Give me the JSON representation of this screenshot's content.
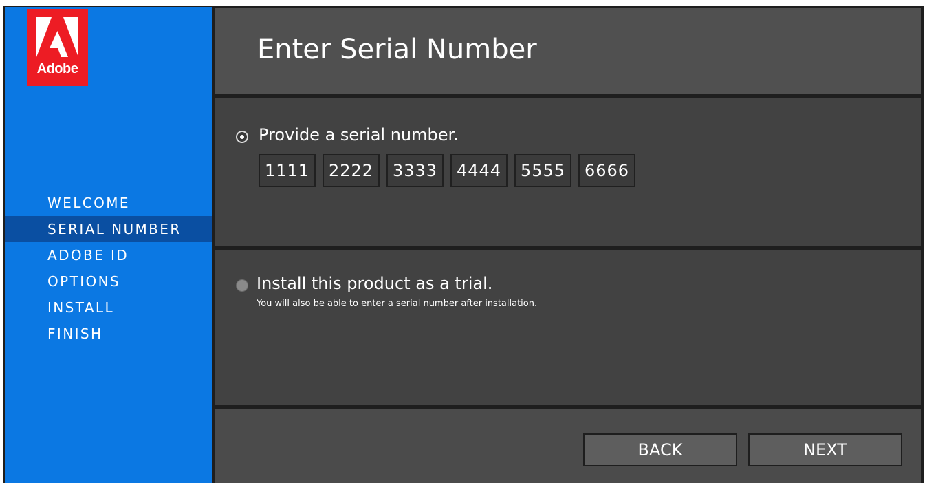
{
  "window_title": "Enter Serial Number",
  "logo": {
    "text": "Adobe",
    "brand_color": "#ed1c24"
  },
  "sidebar": {
    "bg_color": "#0b78e3",
    "active_color": "#0a4fa2",
    "items": [
      {
        "label": "WELCOME",
        "active": false
      },
      {
        "label": "SERIAL NUMBER",
        "active": true
      },
      {
        "label": "ADOBE ID",
        "active": false
      },
      {
        "label": "OPTIONS",
        "active": false
      },
      {
        "label": "INSTALL",
        "active": false
      },
      {
        "label": "FINISH",
        "active": false
      }
    ]
  },
  "options": {
    "serial": {
      "label": "Provide a serial number.",
      "selected": true,
      "fields": [
        "1111",
        "2222",
        "3333",
        "4444",
        "5555",
        "6666"
      ]
    },
    "trial": {
      "label": "Install this product as a trial.",
      "sublabel": "You will also be able to enter a serial number after installation.",
      "selected": false
    }
  },
  "buttons": {
    "back": "BACK",
    "next": "NEXT"
  }
}
